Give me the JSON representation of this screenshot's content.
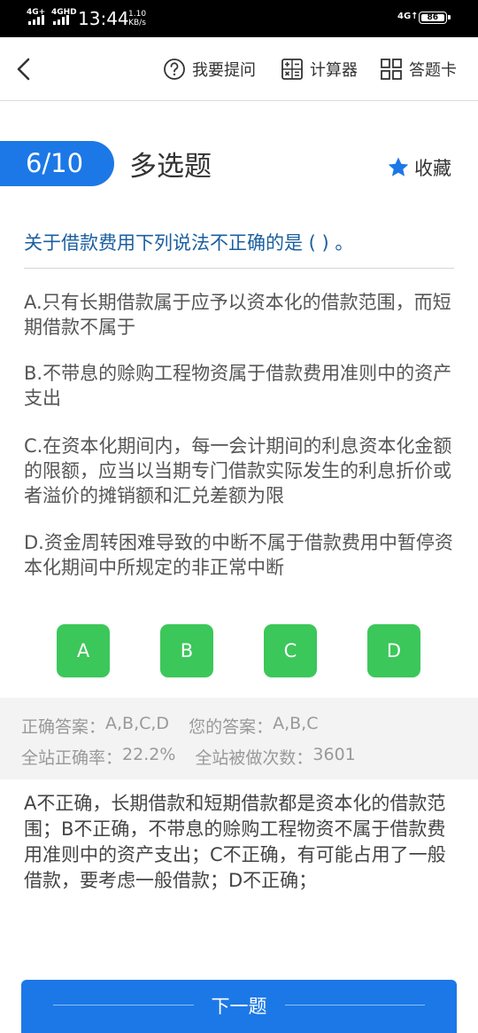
{
  "status_bar": {
    "net1": "4G+",
    "net2": "4GHD",
    "time": "13:44",
    "speed_value": "1.10",
    "speed_unit": "KB/s",
    "net_right": "4G↑",
    "battery": "86"
  },
  "nav": {
    "ask_label": "我要提问",
    "calc_label": "计算器",
    "card_label": "答题卡"
  },
  "question": {
    "index": "6/10",
    "type": "多选题",
    "favorite_label": "收藏",
    "stem": "关于借款费用下列说法不正确的是 ( ) 。",
    "options": [
      {
        "text": "A.只有长期借款属于应予以资本化的借款范围，而短期借款不属于"
      },
      {
        "text": "B.不带息的赊购工程物资属于借款费用准则中的资产支出"
      },
      {
        "text": "C.在资本化期间内，每一会计期间的利息资本化金额的限额，应当以当期专门借款实际发生的利息折价或者溢价的摊销额和汇兑差额为限"
      },
      {
        "text": "D.资金周转困难导致的中断不属于借款费用中暂停资本化期间中所规定的非正常中断"
      }
    ],
    "choices": [
      "A",
      "B",
      "C",
      "D"
    ]
  },
  "result": {
    "correct_label": "正确答案：",
    "correct_value": "A,B,C,D",
    "yours_label": "您的答案：",
    "yours_value": "A,B,C",
    "rate_label": "全站正确率：",
    "rate_value": "22.2%",
    "count_label": "全站被做次数：",
    "count_value": "3601"
  },
  "analysis": "A不正确，长期借款和短期借款都是资本化的借款范围；B不正确，不带息的赊购工程物资不属于借款费用准则中的资产支出；C不正确，有可能占用了一般借款，要考虑一般借款；D不正确；",
  "next_label": "下一题",
  "colors": {
    "primary": "#1c78e6",
    "choice_green": "#3cc75a",
    "stem_blue": "#1b5fa0"
  }
}
